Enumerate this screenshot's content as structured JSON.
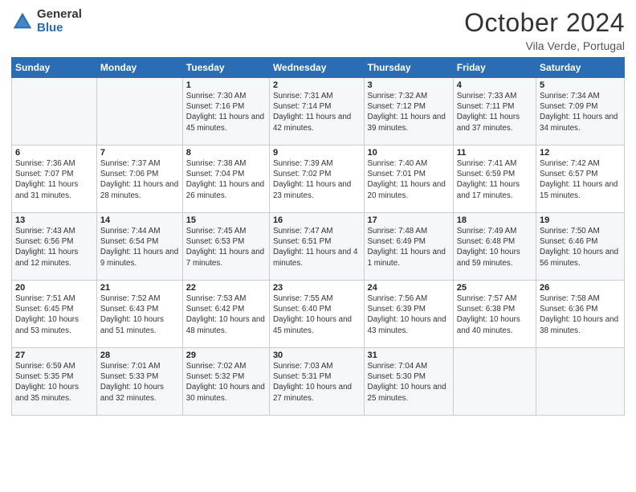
{
  "header": {
    "logo_general": "General",
    "logo_blue": "Blue",
    "month_title": "October 2024",
    "location": "Vila Verde, Portugal"
  },
  "weekdays": [
    "Sunday",
    "Monday",
    "Tuesday",
    "Wednesday",
    "Thursday",
    "Friday",
    "Saturday"
  ],
  "weeks": [
    [
      {
        "day": "",
        "info": ""
      },
      {
        "day": "",
        "info": ""
      },
      {
        "day": "1",
        "info": "Sunrise: 7:30 AM\nSunset: 7:16 PM\nDaylight: 11 hours and 45 minutes."
      },
      {
        "day": "2",
        "info": "Sunrise: 7:31 AM\nSunset: 7:14 PM\nDaylight: 11 hours and 42 minutes."
      },
      {
        "day": "3",
        "info": "Sunrise: 7:32 AM\nSunset: 7:12 PM\nDaylight: 11 hours and 39 minutes."
      },
      {
        "day": "4",
        "info": "Sunrise: 7:33 AM\nSunset: 7:11 PM\nDaylight: 11 hours and 37 minutes."
      },
      {
        "day": "5",
        "info": "Sunrise: 7:34 AM\nSunset: 7:09 PM\nDaylight: 11 hours and 34 minutes."
      }
    ],
    [
      {
        "day": "6",
        "info": "Sunrise: 7:36 AM\nSunset: 7:07 PM\nDaylight: 11 hours and 31 minutes."
      },
      {
        "day": "7",
        "info": "Sunrise: 7:37 AM\nSunset: 7:06 PM\nDaylight: 11 hours and 28 minutes."
      },
      {
        "day": "8",
        "info": "Sunrise: 7:38 AM\nSunset: 7:04 PM\nDaylight: 11 hours and 26 minutes."
      },
      {
        "day": "9",
        "info": "Sunrise: 7:39 AM\nSunset: 7:02 PM\nDaylight: 11 hours and 23 minutes."
      },
      {
        "day": "10",
        "info": "Sunrise: 7:40 AM\nSunset: 7:01 PM\nDaylight: 11 hours and 20 minutes."
      },
      {
        "day": "11",
        "info": "Sunrise: 7:41 AM\nSunset: 6:59 PM\nDaylight: 11 hours and 17 minutes."
      },
      {
        "day": "12",
        "info": "Sunrise: 7:42 AM\nSunset: 6:57 PM\nDaylight: 11 hours and 15 minutes."
      }
    ],
    [
      {
        "day": "13",
        "info": "Sunrise: 7:43 AM\nSunset: 6:56 PM\nDaylight: 11 hours and 12 minutes."
      },
      {
        "day": "14",
        "info": "Sunrise: 7:44 AM\nSunset: 6:54 PM\nDaylight: 11 hours and 9 minutes."
      },
      {
        "day": "15",
        "info": "Sunrise: 7:45 AM\nSunset: 6:53 PM\nDaylight: 11 hours and 7 minutes."
      },
      {
        "day": "16",
        "info": "Sunrise: 7:47 AM\nSunset: 6:51 PM\nDaylight: 11 hours and 4 minutes."
      },
      {
        "day": "17",
        "info": "Sunrise: 7:48 AM\nSunset: 6:49 PM\nDaylight: 11 hours and 1 minute."
      },
      {
        "day": "18",
        "info": "Sunrise: 7:49 AM\nSunset: 6:48 PM\nDaylight: 10 hours and 59 minutes."
      },
      {
        "day": "19",
        "info": "Sunrise: 7:50 AM\nSunset: 6:46 PM\nDaylight: 10 hours and 56 minutes."
      }
    ],
    [
      {
        "day": "20",
        "info": "Sunrise: 7:51 AM\nSunset: 6:45 PM\nDaylight: 10 hours and 53 minutes."
      },
      {
        "day": "21",
        "info": "Sunrise: 7:52 AM\nSunset: 6:43 PM\nDaylight: 10 hours and 51 minutes."
      },
      {
        "day": "22",
        "info": "Sunrise: 7:53 AM\nSunset: 6:42 PM\nDaylight: 10 hours and 48 minutes."
      },
      {
        "day": "23",
        "info": "Sunrise: 7:55 AM\nSunset: 6:40 PM\nDaylight: 10 hours and 45 minutes."
      },
      {
        "day": "24",
        "info": "Sunrise: 7:56 AM\nSunset: 6:39 PM\nDaylight: 10 hours and 43 minutes."
      },
      {
        "day": "25",
        "info": "Sunrise: 7:57 AM\nSunset: 6:38 PM\nDaylight: 10 hours and 40 minutes."
      },
      {
        "day": "26",
        "info": "Sunrise: 7:58 AM\nSunset: 6:36 PM\nDaylight: 10 hours and 38 minutes."
      }
    ],
    [
      {
        "day": "27",
        "info": "Sunrise: 6:59 AM\nSunset: 5:35 PM\nDaylight: 10 hours and 35 minutes."
      },
      {
        "day": "28",
        "info": "Sunrise: 7:01 AM\nSunset: 5:33 PM\nDaylight: 10 hours and 32 minutes."
      },
      {
        "day": "29",
        "info": "Sunrise: 7:02 AM\nSunset: 5:32 PM\nDaylight: 10 hours and 30 minutes."
      },
      {
        "day": "30",
        "info": "Sunrise: 7:03 AM\nSunset: 5:31 PM\nDaylight: 10 hours and 27 minutes."
      },
      {
        "day": "31",
        "info": "Sunrise: 7:04 AM\nSunset: 5:30 PM\nDaylight: 10 hours and 25 minutes."
      },
      {
        "day": "",
        "info": ""
      },
      {
        "day": "",
        "info": ""
      }
    ]
  ]
}
